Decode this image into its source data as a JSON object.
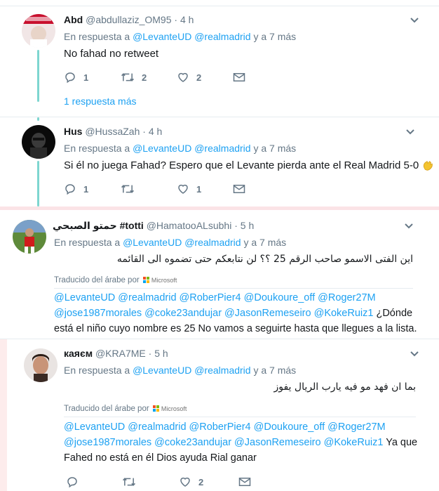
{
  "tweets": [
    {
      "name": "Abd",
      "handle": "@abdullaziz_OM95",
      "dot": "·",
      "time": "4 h",
      "reply_prefix": "En respuesta a",
      "reply_m1": "@LevanteUD",
      "reply_m2": "@realmadrid",
      "reply_suffix": "y a 7 más",
      "text": "No fahad no retweet",
      "replies": "1",
      "retweets": "2",
      "likes": "2",
      "more_replies": "1 respuesta más"
    },
    {
      "name": "Hus",
      "handle": "@HussaZah",
      "dot": "·",
      "time": "4 h",
      "reply_prefix": "En respuesta a",
      "reply_m1": "@LevanteUD",
      "reply_m2": "@realmadrid",
      "reply_suffix": "y a 7 más",
      "text": "Si él no juega Fahad? Espero que el Levante pierda ante el Real Madrid 5-0",
      "replies": "1",
      "retweets": "",
      "likes": "1"
    },
    {
      "name": "حمتو الصبحي #totti",
      "handle": "@HamatooALsubhi",
      "dot": "·",
      "time": "5 h",
      "reply_prefix": "En respuesta a",
      "reply_m1": "@LevanteUD",
      "reply_m2": "@realmadrid",
      "reply_suffix": "y a 7 más",
      "text": "اين الفتى الاسمو صاحب الرقم 25 ؟؟ لن نتابعكم حتى تضموه الى القائمه",
      "translated_by": "Traducido del árabe por",
      "ms_label": "Microsoft",
      "trans_line1": "@LevanteUD @realmadrid @RoberPier4 @Doukoure_off @Roger27M",
      "trans_line2_mentions": "@jose1987morales @coke23andujar @JasonRemeseiro @KokeRuiz1",
      "trans_line2_text": " ¿Dónde",
      "trans_line3": "está el niño cuyo nombre es 25 No vamos a seguirte hasta que llegues a la lista."
    },
    {
      "name": "каяєм",
      "handle": "@KRA7ME",
      "dot": "·",
      "time": "5 h",
      "reply_prefix": "En respuesta a",
      "reply_m1": "@LevanteUD",
      "reply_m2": "@realmadrid",
      "reply_suffix": "y a 7 más",
      "text": "بما ان فهد مو فيه يارب الريال يفوز",
      "translated_by": "Traducido del árabe por",
      "ms_label": "Microsoft",
      "trans_line1": "@LevanteUD @realmadrid @RoberPier4 @Doukoure_off @Roger27M",
      "trans_line2_mentions": "@jose1987morales @coke23andujar @JasonRemeseiro @KokeRuiz1",
      "trans_line2_text": " Ya que",
      "trans_line3": "Fahed no está en él Dios ayuda Rial ganar",
      "replies": "",
      "retweets": "",
      "likes": "2"
    }
  ],
  "colors": {
    "link": "#1da1f2",
    "muted": "#657786",
    "thread": "#7ed6d0"
  },
  "icons": [
    "reply-icon",
    "retweet-icon",
    "like-icon",
    "message-icon",
    "caret-down-icon",
    "clap-emoji-icon",
    "microsoft-logo-icon"
  ]
}
